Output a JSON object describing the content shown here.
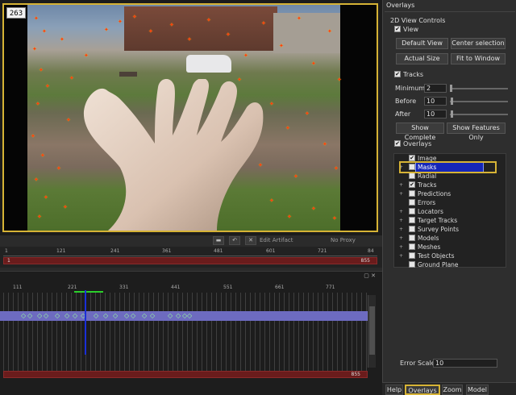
{
  "viewer": {
    "frame_number": "263"
  },
  "vtoolbar": {
    "edit_artifact": "Edit Artifact",
    "proxy": "No Proxy"
  },
  "timeline": {
    "ticks": [
      "1",
      "121",
      "241",
      "361",
      "481",
      "601",
      "721",
      "84"
    ],
    "start_label": "1",
    "end_label": "855"
  },
  "graph": {
    "ticks": [
      "111",
      "221",
      "331",
      "441",
      "551",
      "661",
      "771"
    ],
    "end_label": "855"
  },
  "panel": {
    "title": "Overlays",
    "section_2d": "2D View Controls",
    "view_label": "View",
    "buttons": {
      "default_view": "Default View",
      "center_selection": "Center selection",
      "actual_size": "Actual Size",
      "fit_to_window": "Fit to Window",
      "show_complete": "Show Complete",
      "show_features_only": "Show Features Only"
    },
    "tracks_label": "Tracks",
    "minimum_label": "Minimum",
    "minimum_value": "2",
    "before_label": "Before",
    "before_value": "10",
    "after_label": "After",
    "after_value": "10",
    "overlays_label": "Overlays",
    "tree": [
      {
        "label": "Image",
        "checked": true
      },
      {
        "label": "Masks",
        "checked": false,
        "selected": true
      },
      {
        "label": "Radial",
        "checked": false
      },
      {
        "label": "Tracks",
        "checked": true
      },
      {
        "label": "Predictions",
        "checked": false
      },
      {
        "label": "Errors",
        "checked": false
      },
      {
        "label": "Locators",
        "checked": false
      },
      {
        "label": "Target Tracks",
        "checked": false
      },
      {
        "label": "Survey Points",
        "checked": false
      },
      {
        "label": "Models",
        "checked": false
      },
      {
        "label": "Meshes",
        "checked": false
      },
      {
        "label": "Test Objects",
        "checked": false
      },
      {
        "label": "Ground Plane",
        "checked": false
      }
    ],
    "error_scale_label": "Error Scale",
    "error_scale_value": "10"
  },
  "tabs": [
    "Help",
    "Overlays",
    "Zoom",
    "Model"
  ],
  "colors": {
    "highlight": "#d6b335",
    "selection": "#1526b8",
    "timeline_bar": "#6a1c1c",
    "track_band": "#6d6bc0",
    "feature_marker": "#ff3a10"
  }
}
